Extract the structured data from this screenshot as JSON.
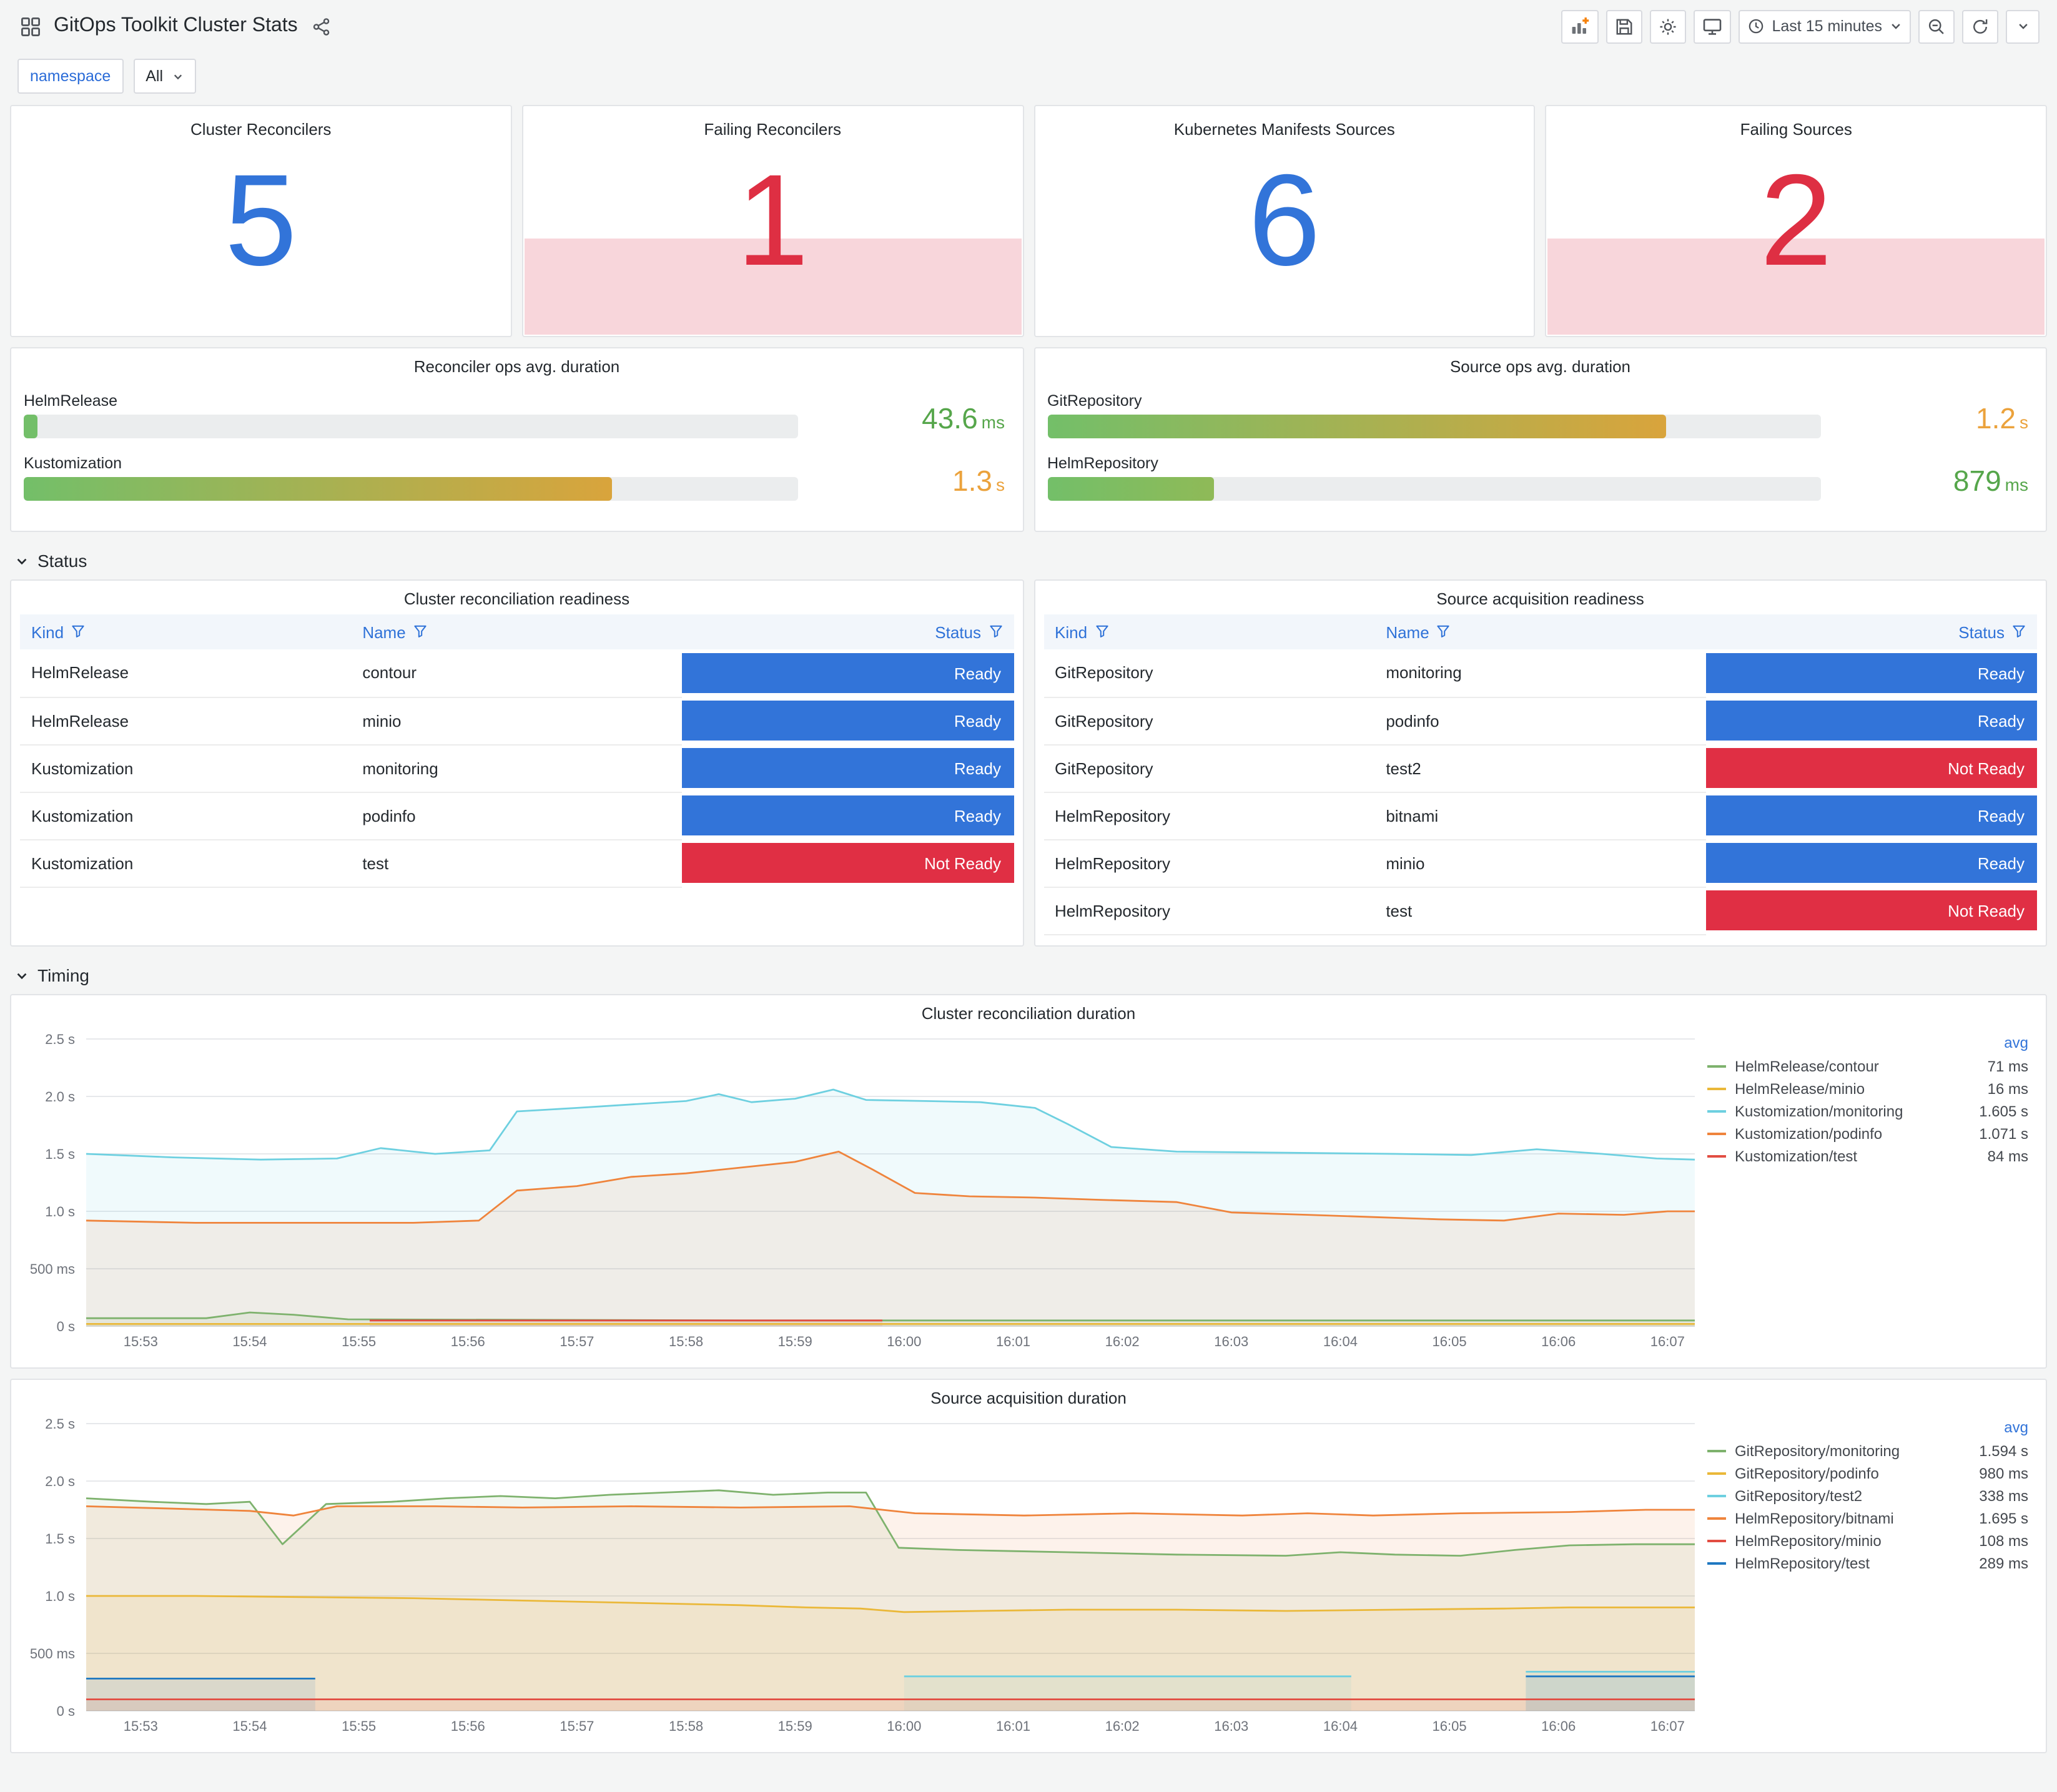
{
  "colors": {
    "accent": "#3274D9",
    "ok_value": "#3274D9",
    "alert_value": "#DE2F43",
    "alert_fill": "#F8D6DB",
    "ready_bg": "#3274D9",
    "not_ready_bg": "#E02F44"
  },
  "header": {
    "title": "GitOps Toolkit Cluster Stats",
    "time_range_label": "Last 15 minutes"
  },
  "variables": {
    "name_label": "namespace",
    "value": "All"
  },
  "sections": {
    "status": "Status",
    "timing": "Timing"
  },
  "stat_panels": [
    {
      "title": "Cluster Reconcilers",
      "value": "5",
      "state": "ok"
    },
    {
      "title": "Failing Reconcilers",
      "value": "1",
      "state": "alert"
    },
    {
      "title": "Kubernetes Manifests Sources",
      "value": "6",
      "state": "ok"
    },
    {
      "title": "Failing Sources",
      "value": "2",
      "state": "alert"
    }
  ],
  "gauge_panels": [
    {
      "title": "Reconciler ops avg. duration",
      "bars": [
        {
          "label": "HelmRelease",
          "value": "43.6",
          "unit": "ms",
          "percent": 1.8,
          "from": "#73BF69",
          "to": "#73BF69",
          "value_color": "#56A64B"
        },
        {
          "label": "Kustomization",
          "value": "1.3",
          "unit": "s",
          "percent": 76,
          "from": "#73BF69",
          "to": "#D9A43C",
          "value_color": "#EBA23C"
        }
      ]
    },
    {
      "title": "Source ops avg. duration",
      "bars": [
        {
          "label": "GitRepository",
          "value": "1.2",
          "unit": "s",
          "percent": 80,
          "from": "#73BF69",
          "to": "#D9A43C",
          "value_color": "#EBA23C"
        },
        {
          "label": "HelmRepository",
          "value": "879",
          "unit": "ms",
          "percent": 21.5,
          "from": "#73BF69",
          "to": "#8FBA57",
          "value_color": "#56A64B"
        }
      ]
    }
  ],
  "tables": [
    {
      "title": "Cluster reconciliation readiness",
      "columns": [
        "Kind",
        "Name",
        "Status"
      ],
      "rows": [
        [
          "HelmRelease",
          "contour",
          "Ready"
        ],
        [
          "HelmRelease",
          "minio",
          "Ready"
        ],
        [
          "Kustomization",
          "monitoring",
          "Ready"
        ],
        [
          "Kustomization",
          "podinfo",
          "Ready"
        ],
        [
          "Kustomization",
          "test",
          "Not Ready"
        ]
      ]
    },
    {
      "title": "Source acquisition readiness",
      "columns": [
        "Kind",
        "Name",
        "Status"
      ],
      "rows": [
        [
          "GitRepository",
          "monitoring",
          "Ready"
        ],
        [
          "GitRepository",
          "podinfo",
          "Ready"
        ],
        [
          "GitRepository",
          "test2",
          "Not Ready"
        ],
        [
          "HelmRepository",
          "bitnami",
          "Ready"
        ],
        [
          "HelmRepository",
          "minio",
          "Ready"
        ],
        [
          "HelmRepository",
          "test",
          "Not Ready"
        ]
      ]
    }
  ],
  "chart_data": [
    {
      "type": "line",
      "title": "Cluster reconciliation duration",
      "legend_header": "avg",
      "ylim": [
        0,
        2.5
      ],
      "y_ticks": [
        {
          "v": 0,
          "label": "0 s"
        },
        {
          "v": 0.5,
          "label": "500 ms"
        },
        {
          "v": 1,
          "label": "1.0 s"
        },
        {
          "v": 1.5,
          "label": "1.5 s"
        },
        {
          "v": 2,
          "label": "2.0 s"
        },
        {
          "v": 2.5,
          "label": "2.5 s"
        }
      ],
      "x_domain": [
        0,
        14.75
      ],
      "x_ticks": [
        {
          "v": 0.5,
          "label": "15:53"
        },
        {
          "v": 1.5,
          "label": "15:54"
        },
        {
          "v": 2.5,
          "label": "15:55"
        },
        {
          "v": 3.5,
          "label": "15:56"
        },
        {
          "v": 4.5,
          "label": "15:57"
        },
        {
          "v": 5.5,
          "label": "15:58"
        },
        {
          "v": 6.5,
          "label": "15:59"
        },
        {
          "v": 7.5,
          "label": "16:00"
        },
        {
          "v": 8.5,
          "label": "16:01"
        },
        {
          "v": 9.5,
          "label": "16:02"
        },
        {
          "v": 10.5,
          "label": "16:03"
        },
        {
          "v": 11.5,
          "label": "16:04"
        },
        {
          "v": 12.5,
          "label": "16:05"
        },
        {
          "v": 13.5,
          "label": "16:06"
        },
        {
          "v": 14.5,
          "label": "16:07"
        }
      ],
      "series": [
        {
          "name": "HelmRelease/contour",
          "color": "#7EB26D",
          "avg": "71 ms",
          "segments": [
            [
              [
                0,
                0.07
              ],
              [
                1.1,
                0.07
              ],
              [
                1.5,
                0.12
              ],
              [
                1.9,
                0.1
              ],
              [
                2.4,
                0.06
              ],
              [
                6,
                0.05
              ],
              [
                14.75,
                0.05
              ]
            ]
          ]
        },
        {
          "name": "HelmRelease/minio",
          "color": "#EAB839",
          "avg": "16 ms",
          "segments": [
            [
              [
                0,
                0.02
              ],
              [
                14.75,
                0.02
              ]
            ]
          ]
        },
        {
          "name": "Kustomization/monitoring",
          "color": "#6ED0E0",
          "avg": "1.605 s",
          "segments": [
            [
              [
                0,
                1.5
              ],
              [
                0.8,
                1.47
              ],
              [
                1.6,
                1.45
              ],
              [
                2.3,
                1.46
              ],
              [
                2.7,
                1.55
              ],
              [
                3.2,
                1.5
              ],
              [
                3.7,
                1.53
              ],
              [
                3.95,
                1.87
              ],
              [
                4.5,
                1.9
              ],
              [
                5,
                1.93
              ],
              [
                5.5,
                1.96
              ],
              [
                5.8,
                2.02
              ],
              [
                6.1,
                1.95
              ],
              [
                6.5,
                1.98
              ],
              [
                6.85,
                2.06
              ],
              [
                7.15,
                1.97
              ],
              [
                7.7,
                1.96
              ],
              [
                8.2,
                1.95
              ],
              [
                8.7,
                1.9
              ],
              [
                9,
                1.76
              ],
              [
                9.4,
                1.56
              ],
              [
                10,
                1.52
              ],
              [
                11,
                1.51
              ],
              [
                12,
                1.5
              ],
              [
                12.7,
                1.49
              ],
              [
                13.3,
                1.54
              ],
              [
                13.9,
                1.5
              ],
              [
                14.4,
                1.46
              ],
              [
                14.75,
                1.45
              ]
            ]
          ]
        },
        {
          "name": "Kustomization/podinfo",
          "color": "#EF843C",
          "avg": "1.071 s",
          "segments": [
            [
              [
                0,
                0.92
              ],
              [
                1,
                0.9
              ],
              [
                2,
                0.9
              ],
              [
                3,
                0.9
              ],
              [
                3.6,
                0.92
              ],
              [
                3.95,
                1.18
              ],
              [
                4.5,
                1.22
              ],
              [
                5,
                1.3
              ],
              [
                5.5,
                1.33
              ],
              [
                6,
                1.38
              ],
              [
                6.5,
                1.43
              ],
              [
                6.9,
                1.52
              ],
              [
                7.2,
                1.37
              ],
              [
                7.6,
                1.16
              ],
              [
                8.1,
                1.13
              ],
              [
                8.7,
                1.12
              ],
              [
                9.3,
                1.1
              ],
              [
                10,
                1.08
              ],
              [
                10.5,
                0.99
              ],
              [
                11.2,
                0.97
              ],
              [
                11.8,
                0.95
              ],
              [
                12.4,
                0.93
              ],
              [
                13,
                0.92
              ],
              [
                13.5,
                0.98
              ],
              [
                14.1,
                0.97
              ],
              [
                14.5,
                1.0
              ],
              [
                14.75,
                1.0
              ]
            ]
          ]
        },
        {
          "name": "Kustomization/test",
          "color": "#E24D42",
          "avg": "84 ms",
          "segments": [
            [
              [
                2.6,
                0.05
              ],
              [
                7.3,
                0.05
              ]
            ]
          ]
        }
      ]
    },
    {
      "type": "line",
      "title": "Source acquisition duration",
      "legend_header": "avg",
      "ylim": [
        0,
        2.5
      ],
      "y_ticks": [
        {
          "v": 0,
          "label": "0 s"
        },
        {
          "v": 0.5,
          "label": "500 ms"
        },
        {
          "v": 1,
          "label": "1.0 s"
        },
        {
          "v": 1.5,
          "label": "1.5 s"
        },
        {
          "v": 2,
          "label": "2.0 s"
        },
        {
          "v": 2.5,
          "label": "2.5 s"
        }
      ],
      "x_domain": [
        0,
        14.75
      ],
      "x_ticks": [
        {
          "v": 0.5,
          "label": "15:53"
        },
        {
          "v": 1.5,
          "label": "15:54"
        },
        {
          "v": 2.5,
          "label": "15:55"
        },
        {
          "v": 3.5,
          "label": "15:56"
        },
        {
          "v": 4.5,
          "label": "15:57"
        },
        {
          "v": 5.5,
          "label": "15:58"
        },
        {
          "v": 6.5,
          "label": "15:59"
        },
        {
          "v": 7.5,
          "label": "16:00"
        },
        {
          "v": 8.5,
          "label": "16:01"
        },
        {
          "v": 9.5,
          "label": "16:02"
        },
        {
          "v": 10.5,
          "label": "16:03"
        },
        {
          "v": 11.5,
          "label": "16:04"
        },
        {
          "v": 12.5,
          "label": "16:05"
        },
        {
          "v": 13.5,
          "label": "16:06"
        },
        {
          "v": 14.5,
          "label": "16:07"
        }
      ],
      "series": [
        {
          "name": "GitRepository/monitoring",
          "color": "#7EB26D",
          "avg": "1.594 s",
          "segments": [
            [
              [
                0,
                1.85
              ],
              [
                0.6,
                1.82
              ],
              [
                1.1,
                1.8
              ],
              [
                1.5,
                1.82
              ],
              [
                1.8,
                1.45
              ],
              [
                2.2,
                1.8
              ],
              [
                2.8,
                1.82
              ],
              [
                3.3,
                1.85
              ],
              [
                3.8,
                1.87
              ],
              [
                4.3,
                1.85
              ],
              [
                4.8,
                1.88
              ],
              [
                5.3,
                1.9
              ],
              [
                5.8,
                1.92
              ],
              [
                6.3,
                1.88
              ],
              [
                6.8,
                1.9
              ],
              [
                7.15,
                1.9
              ],
              [
                7.45,
                1.42
              ],
              [
                8,
                1.4
              ],
              [
                9,
                1.38
              ],
              [
                10,
                1.36
              ],
              [
                11,
                1.35
              ],
              [
                11.5,
                1.38
              ],
              [
                12,
                1.36
              ],
              [
                12.6,
                1.35
              ],
              [
                13.1,
                1.4
              ],
              [
                13.6,
                1.44
              ],
              [
                14.2,
                1.45
              ],
              [
                14.75,
                1.45
              ]
            ]
          ]
        },
        {
          "name": "GitRepository/podinfo",
          "color": "#EAB839",
          "avg": "980 ms",
          "segments": [
            [
              [
                0,
                1.0
              ],
              [
                1,
                1.0
              ],
              [
                2,
                0.99
              ],
              [
                3,
                0.98
              ],
              [
                4,
                0.96
              ],
              [
                5,
                0.94
              ],
              [
                6,
                0.92
              ],
              [
                6.6,
                0.9
              ],
              [
                7.1,
                0.89
              ],
              [
                7.5,
                0.86
              ],
              [
                8.2,
                0.87
              ],
              [
                9,
                0.88
              ],
              [
                10,
                0.88
              ],
              [
                11,
                0.87
              ],
              [
                12,
                0.88
              ],
              [
                13,
                0.89
              ],
              [
                13.6,
                0.9
              ],
              [
                14.75,
                0.9
              ]
            ]
          ]
        },
        {
          "name": "GitRepository/test2",
          "color": "#6ED0E0",
          "avg": "338 ms",
          "segments": [
            [
              [
                7.5,
                0.3
              ],
              [
                11.6,
                0.3
              ]
            ],
            [
              [
                13.2,
                0.34
              ],
              [
                14.75,
                0.34
              ]
            ]
          ]
        },
        {
          "name": "HelmRepository/bitnami",
          "color": "#EF843C",
          "avg": "1.695 s",
          "segments": [
            [
              [
                0,
                1.78
              ],
              [
                0.8,
                1.76
              ],
              [
                1.5,
                1.74
              ],
              [
                1.9,
                1.7
              ],
              [
                2.3,
                1.78
              ],
              [
                3.2,
                1.78
              ],
              [
                4,
                1.77
              ],
              [
                5,
                1.78
              ],
              [
                6,
                1.77
              ],
              [
                7,
                1.78
              ],
              [
                7.6,
                1.72
              ],
              [
                8.6,
                1.7
              ],
              [
                9.6,
                1.72
              ],
              [
                10.6,
                1.7
              ],
              [
                11.2,
                1.72
              ],
              [
                11.8,
                1.7
              ],
              [
                12.6,
                1.72
              ],
              [
                13.6,
                1.73
              ],
              [
                14.3,
                1.75
              ],
              [
                14.75,
                1.75
              ]
            ]
          ]
        },
        {
          "name": "HelmRepository/minio",
          "color": "#E24D42",
          "avg": "108 ms",
          "segments": [
            [
              [
                0,
                0.1
              ],
              [
                14.75,
                0.1
              ]
            ]
          ]
        },
        {
          "name": "HelmRepository/test",
          "color": "#1F78C1",
          "avg": "289 ms",
          "segments": [
            [
              [
                0,
                0.28
              ],
              [
                2.1,
                0.28
              ]
            ],
            [
              [
                13.2,
                0.3
              ],
              [
                14.75,
                0.3
              ]
            ]
          ]
        }
      ]
    }
  ]
}
